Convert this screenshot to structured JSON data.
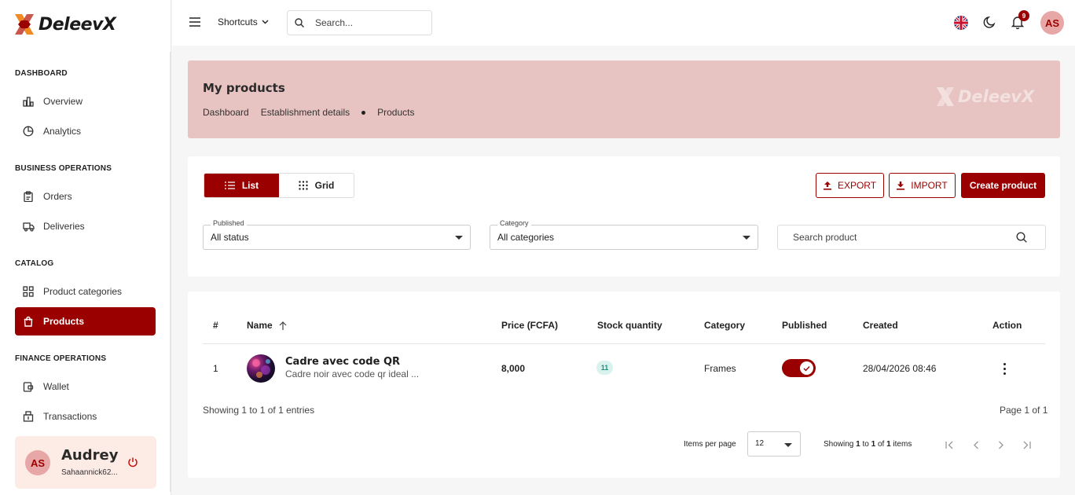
{
  "brand": {
    "name": "DeleevX",
    "accent": "#9b0000"
  },
  "sidebar": {
    "sections": [
      {
        "title": "DASHBOARD",
        "items": [
          {
            "label": "Overview",
            "icon": "bar-chart-icon"
          },
          {
            "label": "Analytics",
            "icon": "pie-chart-icon"
          }
        ]
      },
      {
        "title": "BUSINESS OPERATIONS",
        "items": [
          {
            "label": "Orders",
            "icon": "clipboard-icon"
          },
          {
            "label": "Deliveries",
            "icon": "truck-icon"
          }
        ]
      },
      {
        "title": "CATALOG",
        "items": [
          {
            "label": "Product categories",
            "icon": "grid-icon"
          },
          {
            "label": "Products",
            "icon": "shopping-bag-icon",
            "active": true
          }
        ]
      },
      {
        "title": "FINANCE OPERATIONS",
        "items": [
          {
            "label": "Wallet",
            "icon": "wallet-icon"
          },
          {
            "label": "Transactions",
            "icon": "transactions-icon"
          }
        ]
      }
    ],
    "user": {
      "initials": "AS",
      "name": "Audrey",
      "handle": "Sahaannick62..."
    }
  },
  "topbar": {
    "shortcuts_label": "Shortcuts",
    "search_placeholder": "Search...",
    "notifications_count": "9",
    "avatar_initials": "AS"
  },
  "hero": {
    "title": "My products",
    "breadcrumbs": [
      "Dashboard",
      "Establishment details",
      "Products"
    ],
    "watermark": "DeleevX"
  },
  "toolbar": {
    "view_list": "List",
    "view_grid": "Grid",
    "export_label": "EXPORT",
    "import_label": "IMPORT",
    "create_label": "Create product"
  },
  "filters": {
    "published": {
      "label": "Published",
      "value": "All status"
    },
    "category": {
      "label": "Category",
      "value": "All categories"
    },
    "search_placeholder": "Search product"
  },
  "table": {
    "columns": [
      "#",
      "Name",
      "Price (FCFA)",
      "Stock quantity",
      "Category",
      "Published",
      "Created",
      "Action"
    ],
    "rows": [
      {
        "index": "1",
        "name": "Cadre avec code QR",
        "description": "Cadre noir avec code qr ideal ...",
        "price": "8,000",
        "stock": "11",
        "category": "Frames",
        "published": true,
        "created": "28/04/2026 08:46"
      }
    ],
    "entries_text": "Showing 1 to 1 of 1 entries",
    "page_text": "Page 1 of 1"
  },
  "pagination": {
    "items_per_page_label": "Items per page",
    "items_per_page": "12",
    "showing_prefix": "Showing",
    "from": "1",
    "to_word": "to",
    "to": "1",
    "of_word": "of",
    "total": "1",
    "items_word": "items"
  }
}
